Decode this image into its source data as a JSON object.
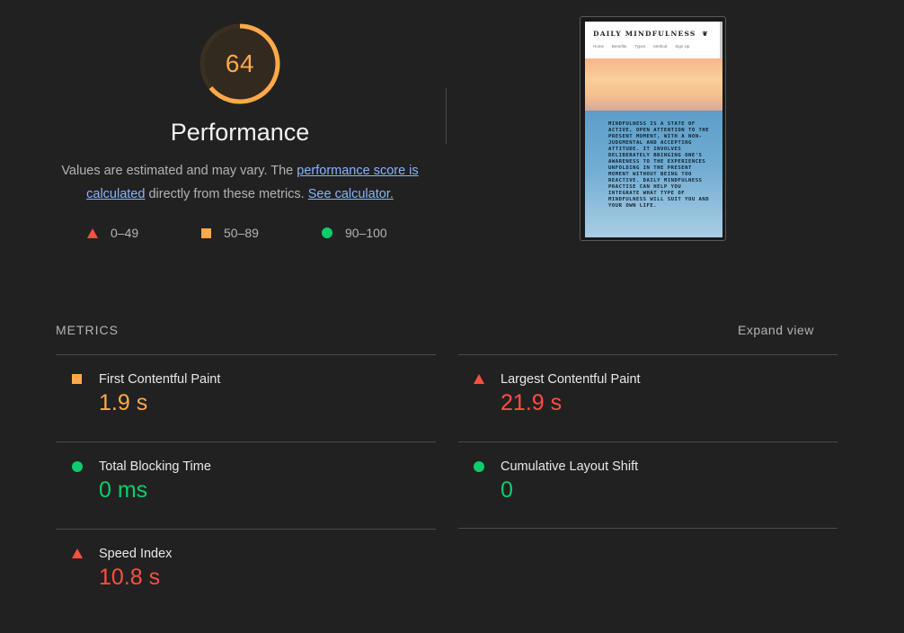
{
  "score": {
    "value": "64",
    "fraction": 0.64,
    "color": "#ffa94a",
    "track_color": "#3b2f22"
  },
  "title": "Performance",
  "description": {
    "text_before": "Values are estimated and may vary. The ",
    "link1": "performance score is calculated",
    "text_middle": " directly from these metrics. ",
    "link2": "See calculator."
  },
  "legend": [
    {
      "shape": "triangle-icon",
      "range": "0–49",
      "color": "#ff4e42"
    },
    {
      "shape": "square-icon",
      "range": "50–89",
      "color": "#ffa94a"
    },
    {
      "shape": "circle-icon",
      "range": "90–100",
      "color": "#0cce6b"
    }
  ],
  "screenshot": {
    "brand": "DAILY MINDFULNESS",
    "brand_icon": "leaf-icon",
    "nav": [
      "Home",
      "Benefits",
      "Types",
      "Method",
      "Sign Up"
    ],
    "body_text": "MINDFULNESS IS A STATE OF ACTIVE, OPEN ATTENTION TO THE PRESENT MOMENT, WITH A NON-JUDGMENTAL AND ACCEPTING ATTITUDE. IT INVOLVES DELIBERATELY BRINGING ONE'S AWARENESS TO THE EXPERIENCES UNFOLDING IN THE PRESENT MOMENT WITHOUT BEING TOO REACTIVE. DAILY MINDFULNESS PRACTISE CAN HELP YOU INTEGRATE WHAT TYPE OF MINDFULNESS WILL SUIT YOU AND YOUR OWN LIFE."
  },
  "metrics": {
    "header": "METRICS",
    "expand": "Expand view",
    "items": [
      {
        "name": "First Contentful Paint",
        "value": "1.9 s",
        "rating": "average",
        "icon": "square-icon",
        "color": "#ffa94a"
      },
      {
        "name": "Largest Contentful Paint",
        "value": "21.9 s",
        "rating": "fail",
        "icon": "triangle-icon",
        "color": "#ff4e42"
      },
      {
        "name": "Total Blocking Time",
        "value": "0 ms",
        "rating": "pass",
        "icon": "circle-icon",
        "color": "#0cce6b"
      },
      {
        "name": "Cumulative Layout Shift",
        "value": "0",
        "rating": "pass",
        "icon": "circle-icon",
        "color": "#0cce6b"
      },
      {
        "name": "Speed Index",
        "value": "10.8 s",
        "rating": "fail",
        "icon": "triangle-icon",
        "color": "#ff4e42"
      }
    ]
  }
}
